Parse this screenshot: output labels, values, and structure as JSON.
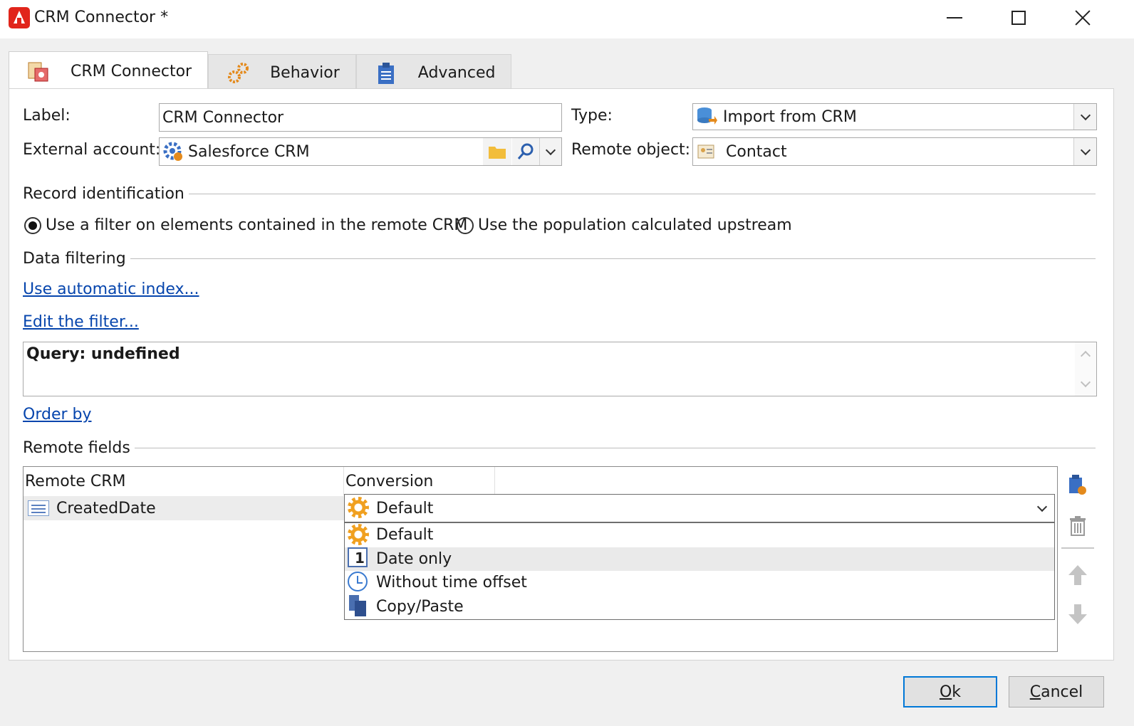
{
  "window": {
    "title": "CRM Connector *"
  },
  "tabs": [
    {
      "label": "CRM Connector",
      "active": true
    },
    {
      "label": "Behavior",
      "active": false
    },
    {
      "label": "Advanced",
      "active": false
    }
  ],
  "form": {
    "label_caption": "Label:",
    "label_value": "CRM Connector",
    "type_caption": "Type:",
    "type_value": "Import from CRM",
    "external_account_caption": "External account:",
    "external_account_value": "Salesforce CRM",
    "remote_object_caption": "Remote object:",
    "remote_object_value": "Contact"
  },
  "record_identification": {
    "title": "Record identification",
    "options": [
      {
        "label": "Use a filter on elements contained in the remote CRM",
        "selected": true
      },
      {
        "label": "Use the population calculated upstream",
        "selected": false
      }
    ]
  },
  "data_filtering": {
    "title": "Data filtering",
    "link_auto_index": "Use automatic index...",
    "link_edit_filter": "Edit the filter...",
    "query_text": "Query: undefined",
    "link_order_by": "Order by"
  },
  "remote_fields": {
    "title": "Remote fields",
    "columns": [
      "Remote CRM",
      "Conversion"
    ],
    "rows": [
      {
        "remote_crm": "CreatedDate",
        "conversion": "Default"
      }
    ],
    "conversion_options": [
      "Default",
      "Date only",
      "Without time offset",
      "Copy/Paste"
    ],
    "highlighted_option": "Date only"
  },
  "buttons": {
    "ok_mnemonic": "O",
    "ok_rest": "k",
    "cancel_mnemonic": "C",
    "cancel_rest": "ancel"
  },
  "colors": {
    "link": "#0645ad",
    "accent_focus": "#0078d7",
    "app_red": "#e1251b"
  }
}
